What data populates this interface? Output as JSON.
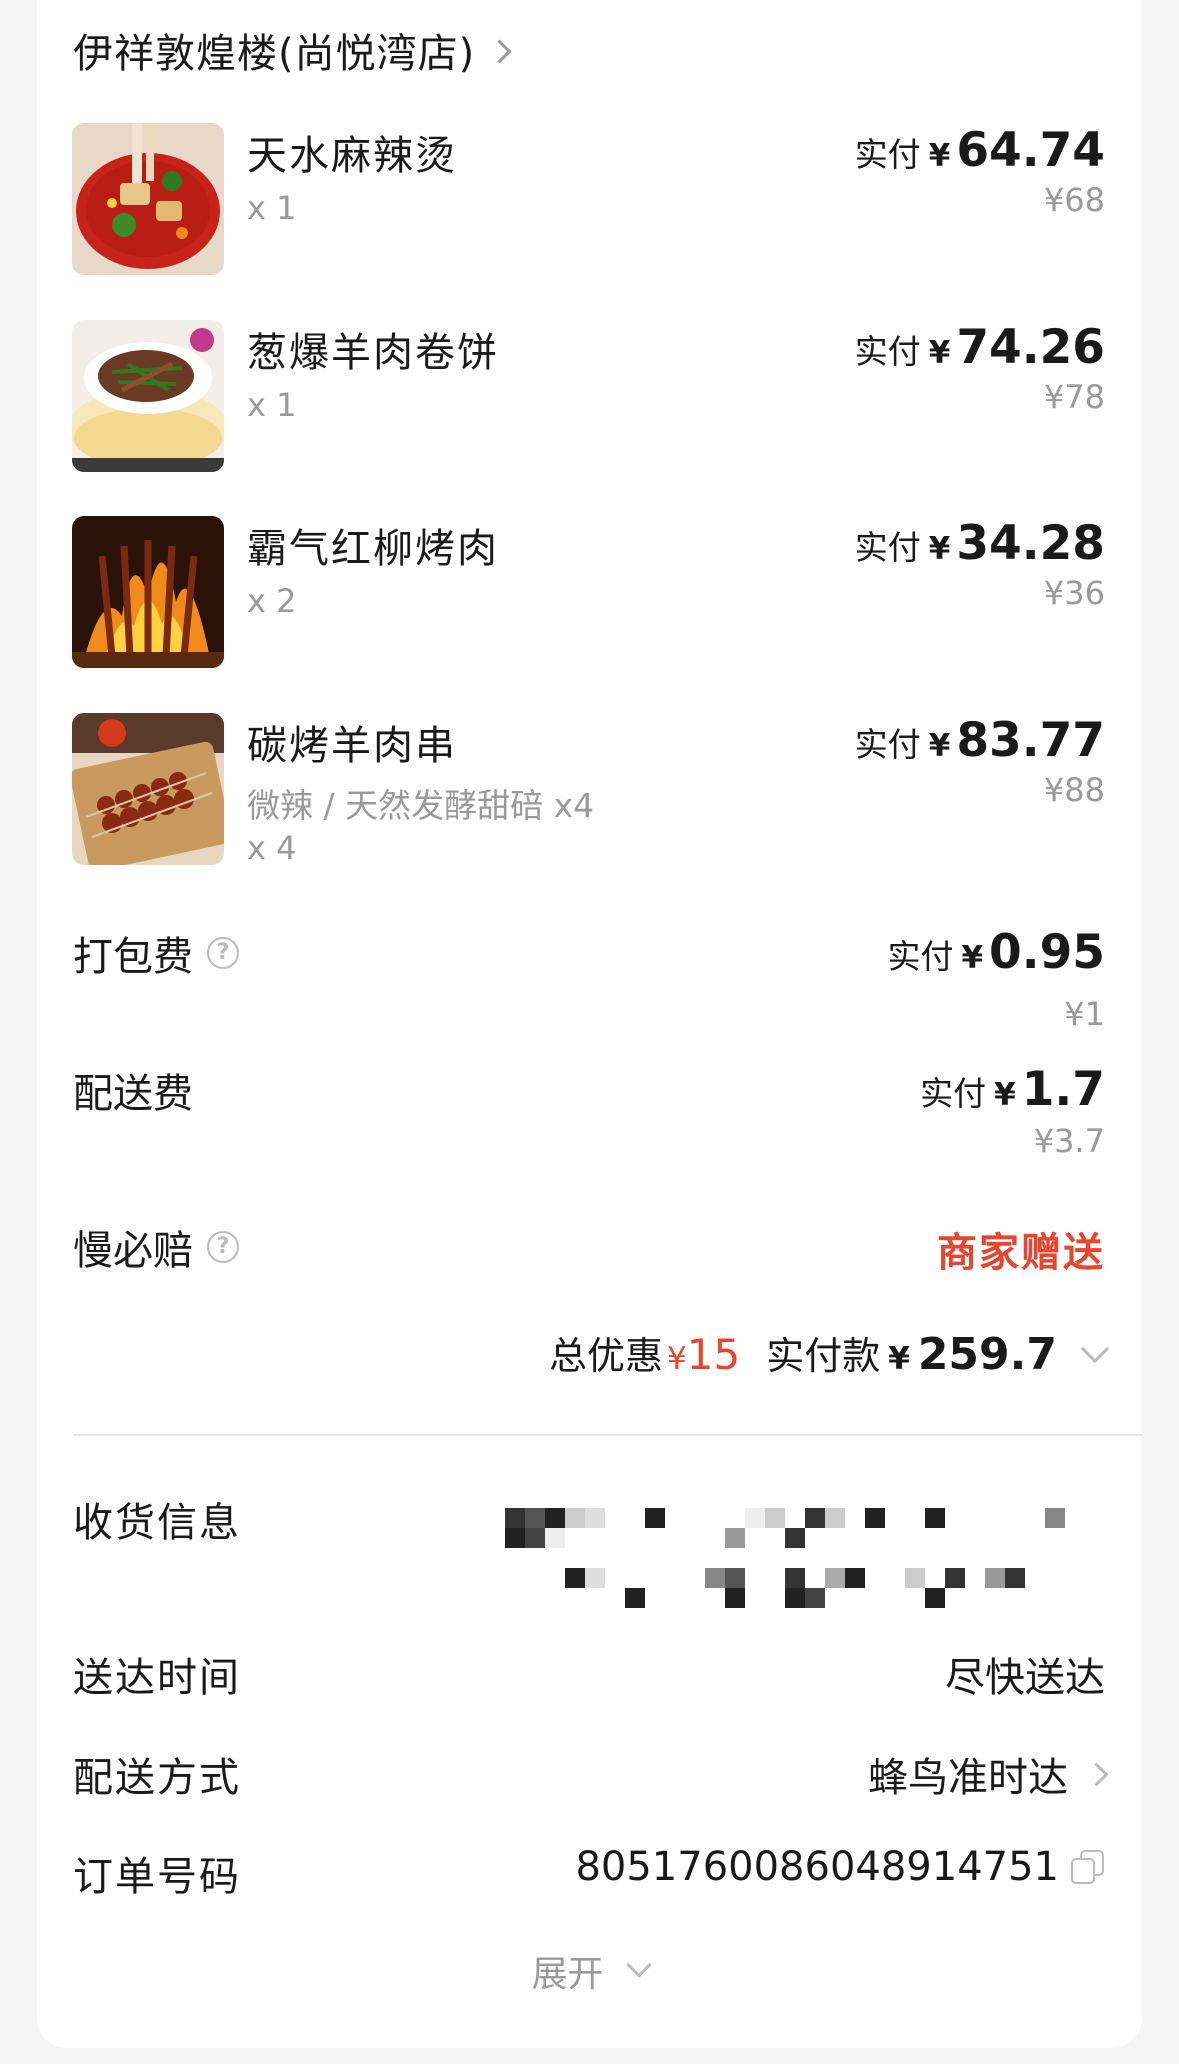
{
  "shop": {
    "name": "伊祥敦煌楼(尚悦湾店)"
  },
  "items": [
    {
      "name": "天水麻辣烫",
      "spec": "",
      "qty": "x 1",
      "paid_label": "实付",
      "currency": "¥",
      "paid": "64.74",
      "original": "¥68",
      "image": "spicy-hotpot-photo"
    },
    {
      "name": "葱爆羊肉卷饼",
      "spec": "",
      "qty": "x 1",
      "paid_label": "实付",
      "currency": "¥",
      "paid": "74.26",
      "original": "¥78",
      "image": "lamb-wrap-photo"
    },
    {
      "name": "霸气红柳烤肉",
      "spec": "",
      "qty": "x 2",
      "paid_label": "实付",
      "currency": "¥",
      "paid": "34.28",
      "original": "¥36",
      "image": "grilled-skewers-fire-photo"
    },
    {
      "name": "碳烤羊肉串",
      "spec": "微辣 / 天然发酵甜碚 x4",
      "qty": "x 4",
      "paid_label": "实付",
      "currency": "¥",
      "paid": "83.77",
      "original": "¥88",
      "image": "lamb-skewers-photo"
    }
  ],
  "fees": {
    "packing": {
      "label": "打包费",
      "paid_label": "实付",
      "currency": "¥",
      "paid": "0.95",
      "original": "¥1"
    },
    "delivery": {
      "label": "配送费",
      "paid_label": "实付",
      "currency": "¥",
      "paid": "1.7",
      "original": "¥3.7"
    },
    "late_comp": {
      "label": "慢必赔",
      "value": "商家赠送"
    }
  },
  "totals": {
    "discount_label": "总优惠",
    "discount_currency": "¥",
    "discount": "15",
    "paid_label": "实付款",
    "currency": "¥",
    "paid": "259.7"
  },
  "info": {
    "address": {
      "label": "收货信息"
    },
    "time": {
      "label": "送达时间",
      "value": "尽快送达"
    },
    "method": {
      "label": "配送方式",
      "value": "蜂鸟准时达"
    },
    "order": {
      "label": "订单号码",
      "value": "8051760086048914751"
    }
  },
  "expand": {
    "label": "展开"
  },
  "colors": {
    "accent": "#e8452f",
    "muted": "#9a9a9a",
    "text": "#1a1a1a"
  }
}
